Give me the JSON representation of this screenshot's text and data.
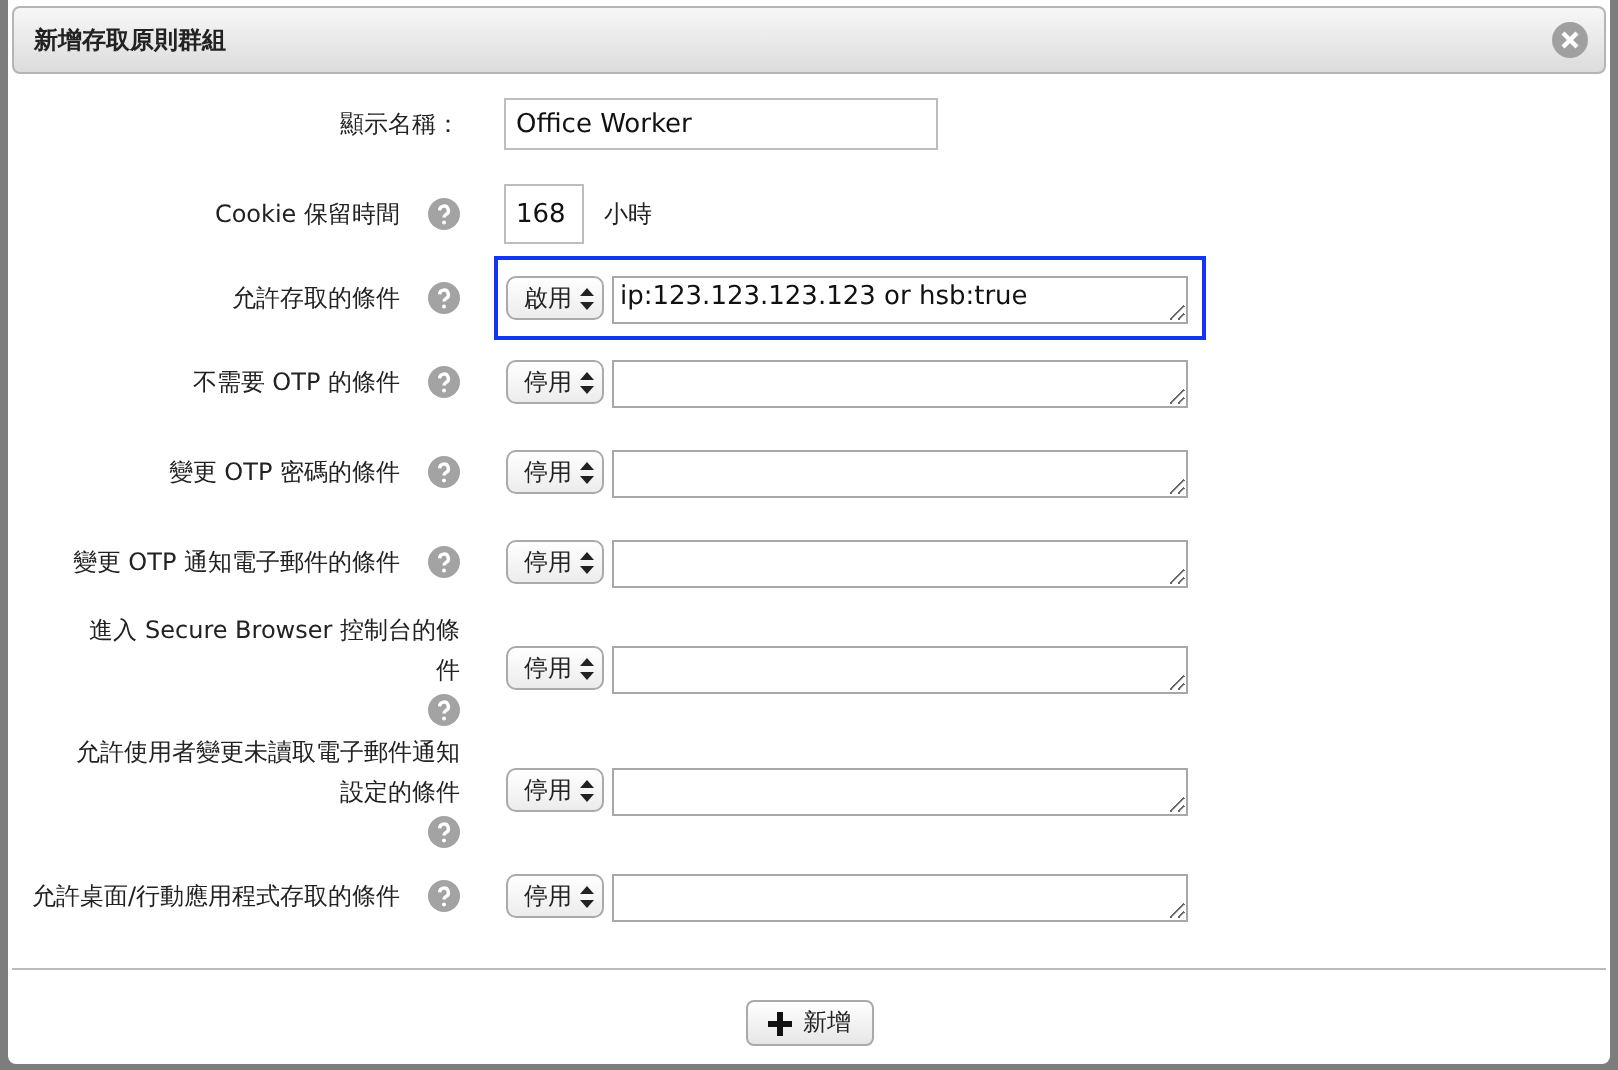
{
  "dialog": {
    "title": "新增存取原則群組"
  },
  "display_name": {
    "label": "顯示名稱：",
    "value": "Office Worker"
  },
  "cookie": {
    "label": "Cookie 保留時間",
    "value": "168",
    "unit": "小時"
  },
  "conditions": [
    {
      "label": "允許存取的條件",
      "mode": "啟用",
      "value": "ip:123.123.123.123 or hsb:true",
      "focused": true
    },
    {
      "label": "不需要 OTP 的條件",
      "mode": "停用",
      "focused": false
    },
    {
      "label": "變更 OTP 密碼的條件",
      "mode": "停用",
      "focused": false
    },
    {
      "label": "變更 OTP 通知電子郵件的條件",
      "mode": "停用",
      "focused": false
    },
    {
      "label": "進入 Secure Browser 控制台的條件",
      "mode": "停用",
      "focused": false
    },
    {
      "label": "允許使用者變更未讀取電子郵件通知設定的條件",
      "mode": "停用",
      "focused": false
    },
    {
      "label": "允許桌面/行動應用程式存取的條件",
      "mode": "停用",
      "focused": false
    }
  ],
  "add_button": {
    "label": "新增"
  }
}
